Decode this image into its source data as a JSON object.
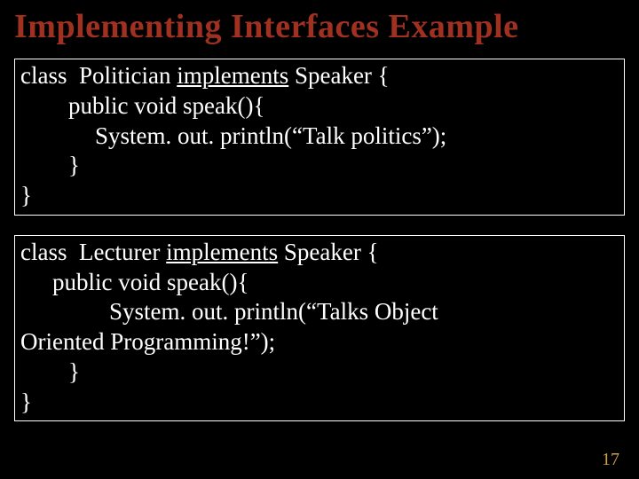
{
  "title": "Implementing Interfaces Example",
  "box1": {
    "l1_a": "class  Politician ",
    "l1_b": "implements",
    "l1_c": " Speaker {",
    "l2": "public void speak(){",
    "l3": "System. out. println(“Talk politics”);",
    "l4": "}",
    "l5": "}"
  },
  "box2": {
    "l1_a": "class  Lecturer ",
    "l1_b": "implements",
    "l1_c": " Speaker {",
    "l2": "public void speak(){",
    "l3": "System. out. println(“Talks Object",
    "l4": "Oriented Programming!”);",
    "l5": "}",
    "l6": "}"
  },
  "pagenum": "17"
}
